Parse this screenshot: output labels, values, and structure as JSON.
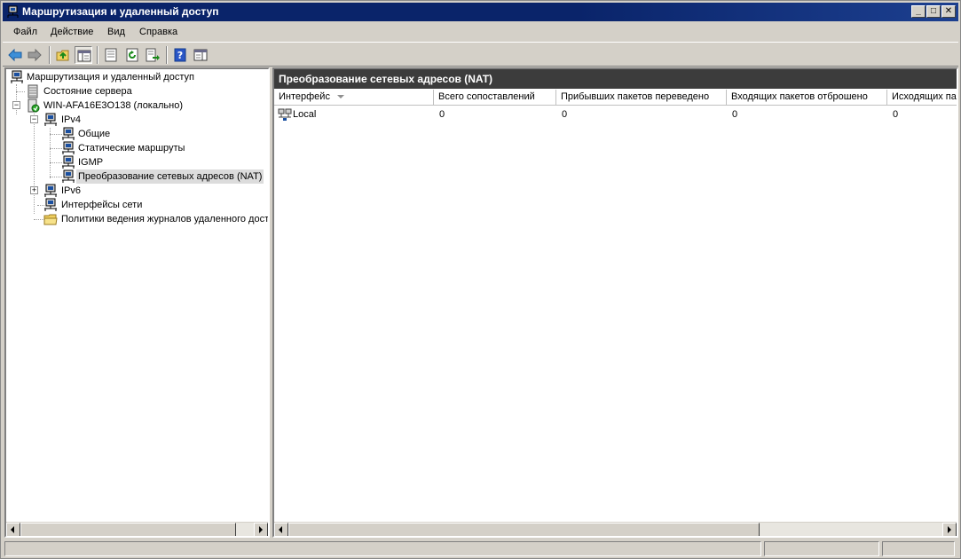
{
  "window": {
    "title": "Маршрутизация и удаленный доступ",
    "minimize": "_",
    "maximize": "□",
    "close": "✕"
  },
  "menu": {
    "items": [
      {
        "label": "Файл"
      },
      {
        "label": "Действие"
      },
      {
        "label": "Вид"
      },
      {
        "label": "Справка"
      }
    ]
  },
  "toolbar": {
    "buttons": [
      {
        "icon": "back-arrow-icon"
      },
      {
        "icon": "forward-arrow-icon"
      },
      {
        "icon": "up-folder-icon"
      },
      {
        "icon": "show-hide-console-tree-icon"
      },
      {
        "icon": "properties-icon"
      },
      {
        "icon": "refresh-icon"
      },
      {
        "icon": "export-list-icon"
      },
      {
        "icon": "help-icon"
      },
      {
        "icon": "show-action-pane-icon"
      }
    ]
  },
  "tree": {
    "root": "Маршрутизация и удаленный доступ",
    "server_status": "Состояние сервера",
    "server": "WIN-AFA16E3O138 (локально)",
    "ipv4": "IPv4",
    "general": "Общие",
    "static_routes": "Статические маршруты",
    "igmp": "IGMP",
    "nat": "Преобразование сетевых адресов (NAT)",
    "ipv6": "IPv6",
    "interfaces": "Интерфейсы сети",
    "logging": "Политики ведения журналов удаленного доступа",
    "expander_minus": "−",
    "expander_plus": "+"
  },
  "details": {
    "header": "Преобразование сетевых адресов (NAT)",
    "columns": [
      "Интерфейс",
      "Всего сопоставлений",
      "Прибывших пакетов переведено",
      "Входящих пакетов отброшено",
      "Исходящих пакетов переведено"
    ],
    "rows": [
      {
        "interface": "Local",
        "total": "0",
        "inbound_translated": "0",
        "inbound_rejected": "0",
        "outbound_translated": "0"
      }
    ]
  },
  "status": {
    "panels": [
      "",
      "",
      ""
    ]
  }
}
